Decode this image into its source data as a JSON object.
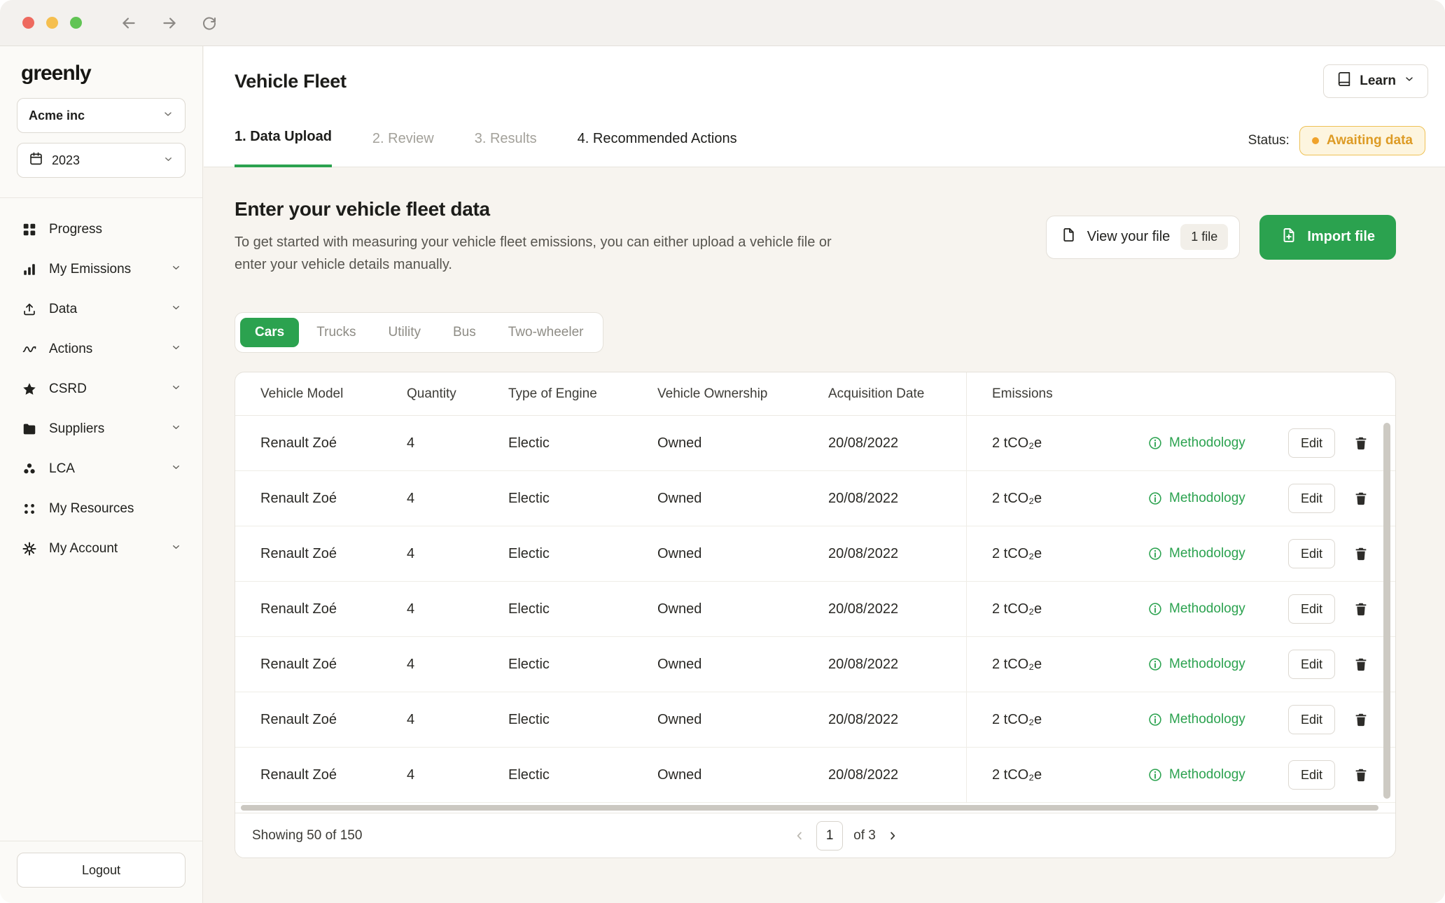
{
  "sidebar": {
    "logo": "greenly",
    "company": "Acme inc",
    "year": "2023",
    "items": [
      {
        "label": "Progress"
      },
      {
        "label": "My Emissions"
      },
      {
        "label": "Data"
      },
      {
        "label": "Actions"
      },
      {
        "label": "CSRD"
      },
      {
        "label": "Suppliers"
      },
      {
        "label": "LCA"
      },
      {
        "label": "My Resources"
      },
      {
        "label": "My Account"
      }
    ],
    "logout": "Logout"
  },
  "header": {
    "title": "Vehicle Fleet",
    "learn": "Learn"
  },
  "tabs": [
    {
      "label": "1. Data Upload"
    },
    {
      "label": "2. Review"
    },
    {
      "label": "3. Results"
    },
    {
      "label": "4. Recommended Actions"
    }
  ],
  "status": {
    "label": "Status:",
    "value": "Awaiting data"
  },
  "section": {
    "title": "Enter your vehicle fleet data",
    "description": "To get started with measuring your vehicle fleet emissions, you can either upload a vehicle file or enter your vehicle details manually.",
    "view_file": "View your file",
    "file_badge": "1 file",
    "import": "Import file"
  },
  "filters": [
    {
      "label": "Cars",
      "active": true
    },
    {
      "label": "Trucks"
    },
    {
      "label": "Utility"
    },
    {
      "label": "Bus"
    },
    {
      "label": "Two-wheeler"
    }
  ],
  "table": {
    "columns": [
      "Vehicle Model",
      "Quantity",
      "Type of Engine",
      "Vehicle Ownership",
      "Acquisition Date",
      "Emissions"
    ],
    "rows": [
      {
        "model": "Renault Zoé",
        "quantity": "4",
        "engine": "Electic",
        "ownership": "Owned",
        "date": "20/08/2022",
        "emissions": "2 tCO₂e",
        "methodology": "Methodology",
        "edit": "Edit"
      },
      {
        "model": "Renault Zoé",
        "quantity": "4",
        "engine": "Electic",
        "ownership": "Owned",
        "date": "20/08/2022",
        "emissions": "2 tCO₂e",
        "methodology": "Methodology",
        "edit": "Edit"
      },
      {
        "model": "Renault Zoé",
        "quantity": "4",
        "engine": "Electic",
        "ownership": "Owned",
        "date": "20/08/2022",
        "emissions": "2 tCO₂e",
        "methodology": "Methodology",
        "edit": "Edit"
      },
      {
        "model": "Renault Zoé",
        "quantity": "4",
        "engine": "Electic",
        "ownership": "Owned",
        "date": "20/08/2022",
        "emissions": "2 tCO₂e",
        "methodology": "Methodology",
        "edit": "Edit"
      },
      {
        "model": "Renault Zoé",
        "quantity": "4",
        "engine": "Electic",
        "ownership": "Owned",
        "date": "20/08/2022",
        "emissions": "2 tCO₂e",
        "methodology": "Methodology",
        "edit": "Edit"
      },
      {
        "model": "Renault Zoé",
        "quantity": "4",
        "engine": "Electic",
        "ownership": "Owned",
        "date": "20/08/2022",
        "emissions": "2 tCO₂e",
        "methodology": "Methodology",
        "edit": "Edit"
      },
      {
        "model": "Renault Zoé",
        "quantity": "4",
        "engine": "Electic",
        "ownership": "Owned",
        "date": "20/08/2022",
        "emissions": "2 tCO₂e",
        "methodology": "Methodology",
        "edit": "Edit"
      }
    ]
  },
  "pagination": {
    "showing": "Showing 50 of 150",
    "page": "1",
    "of_total": "of 3"
  },
  "colors": {
    "accent_green": "#2ba24f",
    "status_orange": "#dd9b25"
  }
}
